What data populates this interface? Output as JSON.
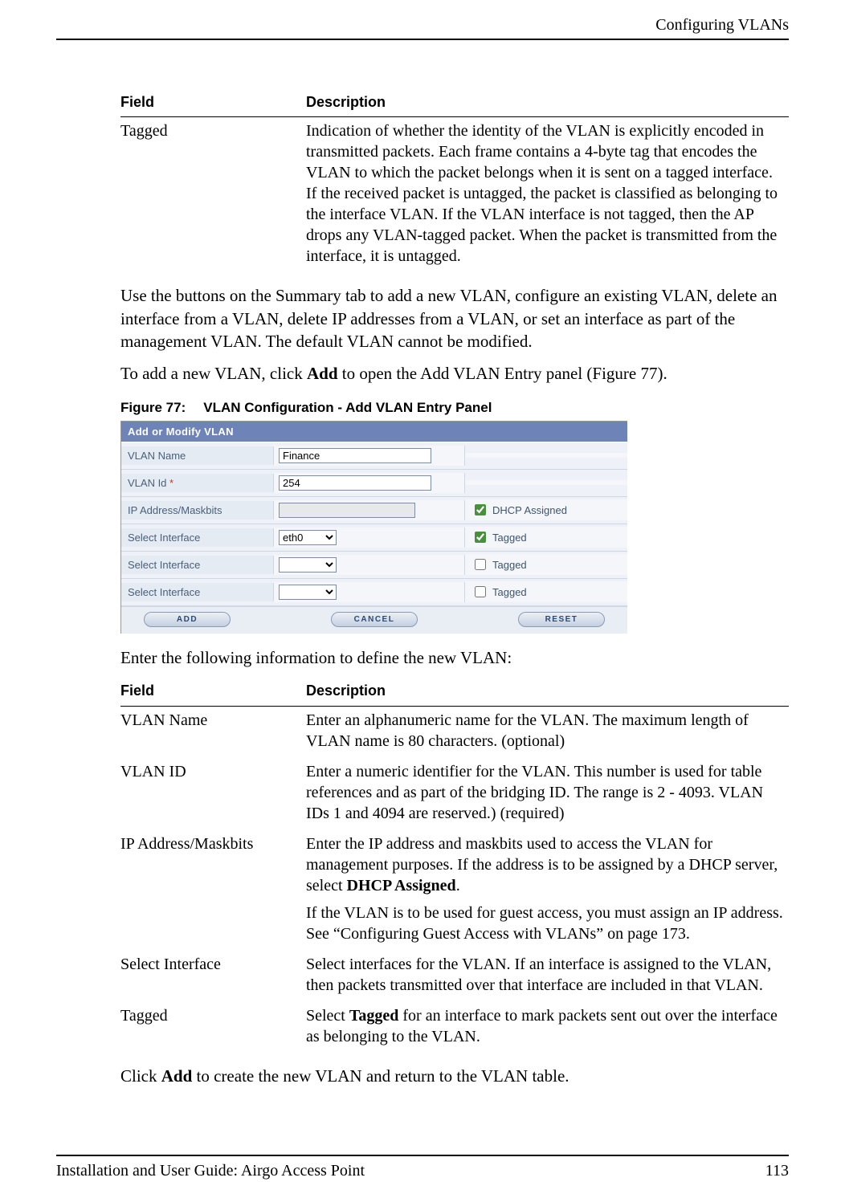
{
  "header": {
    "section": "Configuring VLANs"
  },
  "footer": {
    "left": "Installation and User Guide: Airgo Access Point",
    "right": "113"
  },
  "table1": {
    "head_field": "Field",
    "head_desc": "Description",
    "rows": [
      {
        "field": "Tagged",
        "desc": "Indication of whether the identity of the VLAN is explicitly encoded in transmitted packets. Each frame contains a 4-byte tag that encodes the VLAN to which the packet belongs when it is sent on a tagged interface. If the received packet is untagged, the packet is classified as belonging to the interface VLAN. If the VLAN interface is not tagged, then the AP drops any VLAN-tagged packet. When the packet is transmitted from the interface, it is untagged."
      }
    ]
  },
  "para1": "Use the buttons on the Summary tab to add a new VLAN, configure an existing VLAN, delete an interface from a VLAN, delete IP addresses from a VLAN, or set an interface as part of the management VLAN. The default VLAN cannot be modified.",
  "para2_pre": "To add a new VLAN, click ",
  "para2_bold": "Add",
  "para2_post": " to open the Add VLAN Entry panel (Figure 77).",
  "figcap": {
    "num": "Figure 77:",
    "title": "VLAN Configuration - Add VLAN Entry Panel"
  },
  "panel": {
    "title": "Add or Modify VLAN",
    "rows": {
      "name": {
        "label": "VLAN Name",
        "value": "Finance"
      },
      "id": {
        "label": "VLAN Id",
        "req": "*",
        "value": "254"
      },
      "ip": {
        "label": "IP Address/Maskbits",
        "value": "",
        "cb_label": "DHCP Assigned",
        "cb_checked": true
      },
      "if1": {
        "label": "Select Interface",
        "value": "eth0",
        "cb_label": "Tagged",
        "cb_checked": true
      },
      "if2": {
        "label": "Select Interface",
        "value": "",
        "cb_label": "Tagged",
        "cb_checked": false
      },
      "if3": {
        "label": "Select Interface",
        "value": "",
        "cb_label": "Tagged",
        "cb_checked": false
      }
    },
    "buttons": {
      "add": "ADD",
      "cancel": "CANCEL",
      "reset": "RESET"
    }
  },
  "para3": "Enter the following information to define the new VLAN:",
  "table2": {
    "head_field": "Field",
    "head_desc": "Description",
    "rows": {
      "vlan_name": {
        "field": "VLAN Name",
        "desc": "Enter an alphanumeric name for the VLAN. The maximum length of VLAN name is 80 characters. (optional)"
      },
      "vlan_id": {
        "field": "VLAN ID",
        "desc": "Enter a numeric identifier for the VLAN. This number is used for table references and as part of the bridging ID. The range is 2 - 4093. VLAN IDs 1 and 4094 are reserved.) (required)"
      },
      "ip": {
        "field": "IP Address/Maskbits",
        "desc_a": "Enter the IP address and maskbits used to access the VLAN for management purposes. If the address is to be assigned by a DHCP server, select ",
        "desc_bold": "DHCP Assigned",
        "desc_b": ".",
        "desc2": "If the VLAN is to be used for guest access, you must assign an IP address. See “Configuring Guest Access with VLANs” on page 173."
      },
      "iface": {
        "field": "Select Interface",
        "desc": "Select interfaces for the VLAN. If an interface is assigned to the VLAN, then packets transmitted over that interface are included in that VLAN."
      },
      "tagged": {
        "field": "Tagged",
        "desc_a": "Select ",
        "desc_bold": "Tagged",
        "desc_b": " for an interface to mark packets sent out over the interface as belonging to the VLAN."
      }
    }
  },
  "para4_pre": "Click ",
  "para4_bold": "Add",
  "para4_post": " to create the new VLAN and return to the VLAN table."
}
